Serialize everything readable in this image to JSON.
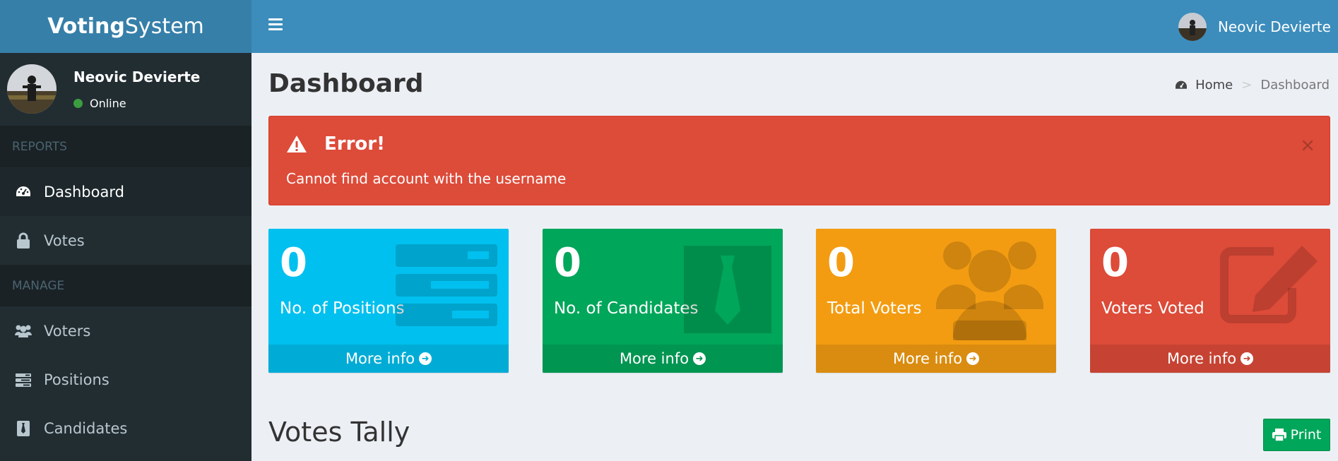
{
  "brand": {
    "bold": "Voting",
    "rest": "System"
  },
  "navbar": {
    "user_name": "Neovic Devierte",
    "menu_icon": "hamburger-icon"
  },
  "sidebar": {
    "user": {
      "name": "Neovic Devierte",
      "status": "Online"
    },
    "sections": [
      {
        "header": "REPORTS"
      },
      {
        "header": "MANAGE"
      }
    ],
    "items": [
      {
        "label": "Dashboard",
        "icon": "dashboard-icon"
      },
      {
        "label": "Votes",
        "icon": "lock-icon"
      },
      {
        "label": "Voters",
        "icon": "users-icon"
      },
      {
        "label": "Positions",
        "icon": "tasks-icon"
      },
      {
        "label": "Candidates",
        "icon": "tie-icon"
      }
    ]
  },
  "page": {
    "title": "Dashboard",
    "breadcrumb": {
      "home": "Home",
      "separator": ">",
      "current": "Dashboard"
    }
  },
  "alert": {
    "title": "Error!",
    "message": "Cannot find account with the username",
    "close": "×"
  },
  "stats": [
    {
      "value": "0",
      "label": "No. of Positions",
      "link": "More info",
      "color": "#00c0ef",
      "footer_color": "#00acd6"
    },
    {
      "value": "0",
      "label": "No. of Candidates",
      "link": "More info",
      "color": "#00a65a",
      "footer_color": "#009551"
    },
    {
      "value": "0",
      "label": "Total Voters",
      "link": "More info",
      "color": "#f39c12",
      "footer_color": "#da8c10"
    },
    {
      "value": "0",
      "label": "Voters Voted",
      "link": "More info",
      "color": "#dd4b39",
      "footer_color": "#c64333"
    }
  ],
  "tally": {
    "title": "Votes Tally",
    "print_label": "Print"
  },
  "colors": {
    "navbar": "#3c8dbc",
    "logo": "#367fa9",
    "sidebar": "#222d32",
    "alert": "#dd4b39",
    "print_button": "#00a65a"
  }
}
